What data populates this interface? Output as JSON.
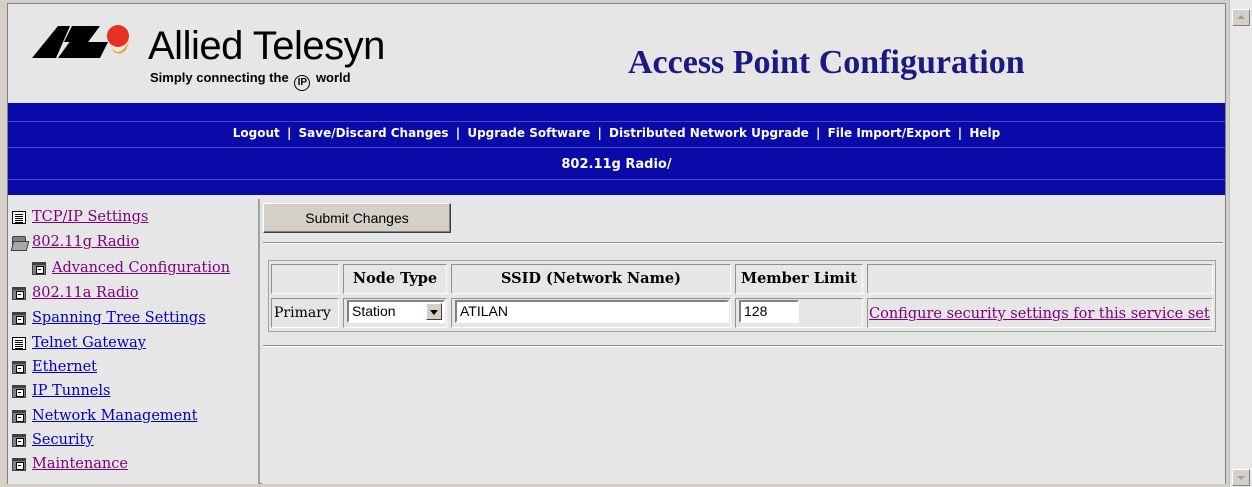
{
  "header": {
    "logo_text": "Allied Telesyn",
    "tagline_before": "Simply connecting the",
    "tagline_ip": "IP",
    "tagline_after": "world",
    "page_title": "Access Point Configuration"
  },
  "nav": {
    "links": [
      "Logout",
      "Save/Discard Changes",
      "Upgrade Software",
      "Distributed Network Upgrade",
      "File Import/Export",
      "Help"
    ],
    "separator": "|",
    "breadcrumb": "802.11g Radio/"
  },
  "sidebar": {
    "items": [
      {
        "label": "TCP/IP Settings",
        "icon": "page-icon"
      },
      {
        "label": "802.11g Radio",
        "icon": "open-folder-icon"
      },
      {
        "label": "Advanced Configuration",
        "icon": "folder-icon"
      },
      {
        "label": "802.11a Radio",
        "icon": "folder-icon"
      },
      {
        "label": "Spanning Tree Settings",
        "icon": "folder-icon"
      },
      {
        "label": "Telnet Gateway",
        "icon": "page-icon"
      },
      {
        "label": "Ethernet",
        "icon": "folder-icon"
      },
      {
        "label": "IP Tunnels",
        "icon": "folder-icon"
      },
      {
        "label": "Network Management",
        "icon": "folder-icon"
      },
      {
        "label": "Security",
        "icon": "folder-icon"
      },
      {
        "label": "Maintenance",
        "icon": "folder-icon"
      }
    ]
  },
  "main": {
    "submit_label": "Submit Changes",
    "table": {
      "headers": [
        "",
        "Node Type",
        "SSID (Network Name)",
        "Member Limit",
        ""
      ],
      "row": {
        "label": "Primary",
        "node_type": "Station",
        "ssid": "ATILAN",
        "member_limit": "128",
        "security_link": "Configure security settings for this service set"
      }
    }
  },
  "colors": {
    "nav_band": "#0a0aa8",
    "title": "#1a1a80",
    "link_visited": "#800080",
    "link": "#0000c8",
    "background": "#e6e6e6"
  }
}
